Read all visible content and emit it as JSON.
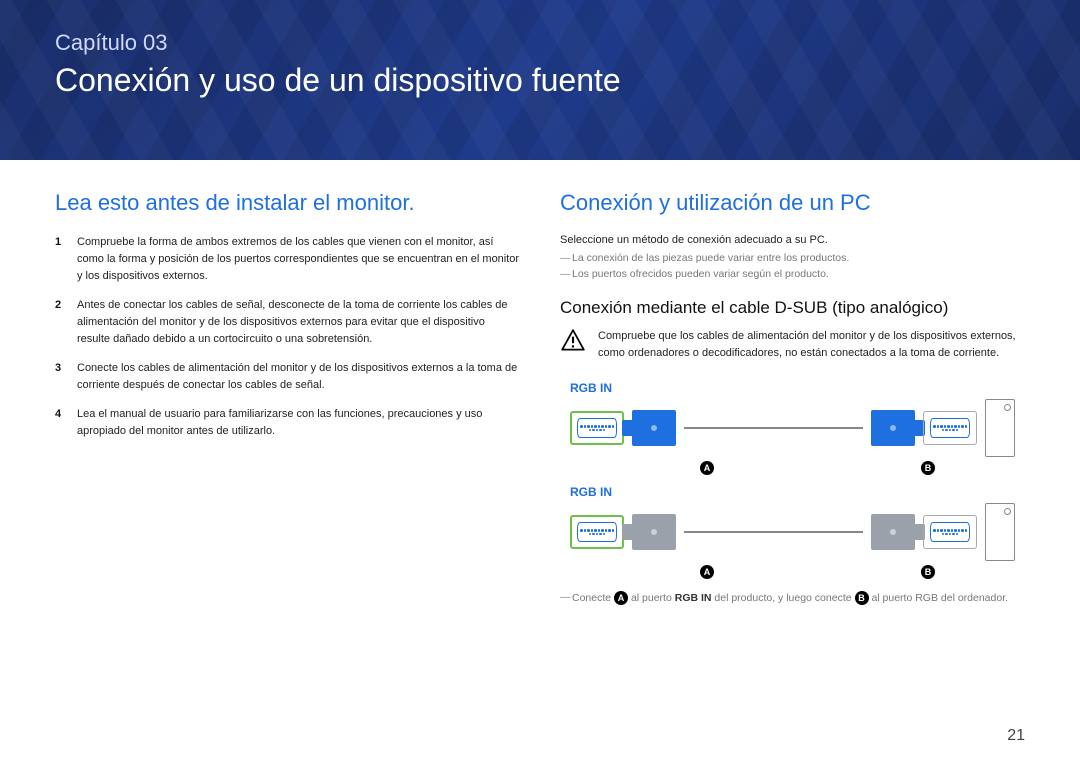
{
  "hero": {
    "kicker": "Capítulo 03",
    "title": "Conexión y uso de un dispositivo fuente"
  },
  "left": {
    "heading": "Lea esto antes de instalar el monitor.",
    "items": [
      "Compruebe la forma de ambos extremos de los cables que vienen con el monitor, así como la forma y posición de los puertos correspondientes que se encuentran en el monitor y los dispositivos externos.",
      "Antes de conectar los cables de señal, desconecte de la toma de corriente los cables de alimentación del monitor y de los dispositivos externos para evitar que el dispositivo resulte dañado debido a un cortocircuito o una sobretensión.",
      "Conecte los cables de alimentación del monitor y de los dispositivos externos a la toma de corriente después de conectar los cables de señal.",
      "Lea el manual de usuario para familiarizarse con las funciones, precauciones y uso apropiado del monitor antes de utilizarlo."
    ]
  },
  "right": {
    "heading": "Conexión y utilización de un PC",
    "intro": "Seleccione un método de conexión adecuado a su PC.",
    "notes": [
      "La conexión de las piezas puede variar entre los productos.",
      "Los puertos ofrecidos pueden variar según el producto."
    ],
    "sub_heading": "Conexión mediante el cable D-SUB (tipo analógico)",
    "warning": "Compruebe que los cables de alimentación del monitor y de los dispositivos externos, como ordenadores o decodificadores, no están conectados a la toma de corriente.",
    "port_label_1": "RGB IN",
    "port_label_2": "RGB IN",
    "badge_a": "A",
    "badge_b": "B",
    "footnote_pre": "Conecte ",
    "footnote_mid1": " al puerto ",
    "footnote_port": "RGB IN",
    "footnote_mid2": " del producto, y luego conecte ",
    "footnote_post": " al puerto RGB del ordenador."
  },
  "page_number": "21"
}
